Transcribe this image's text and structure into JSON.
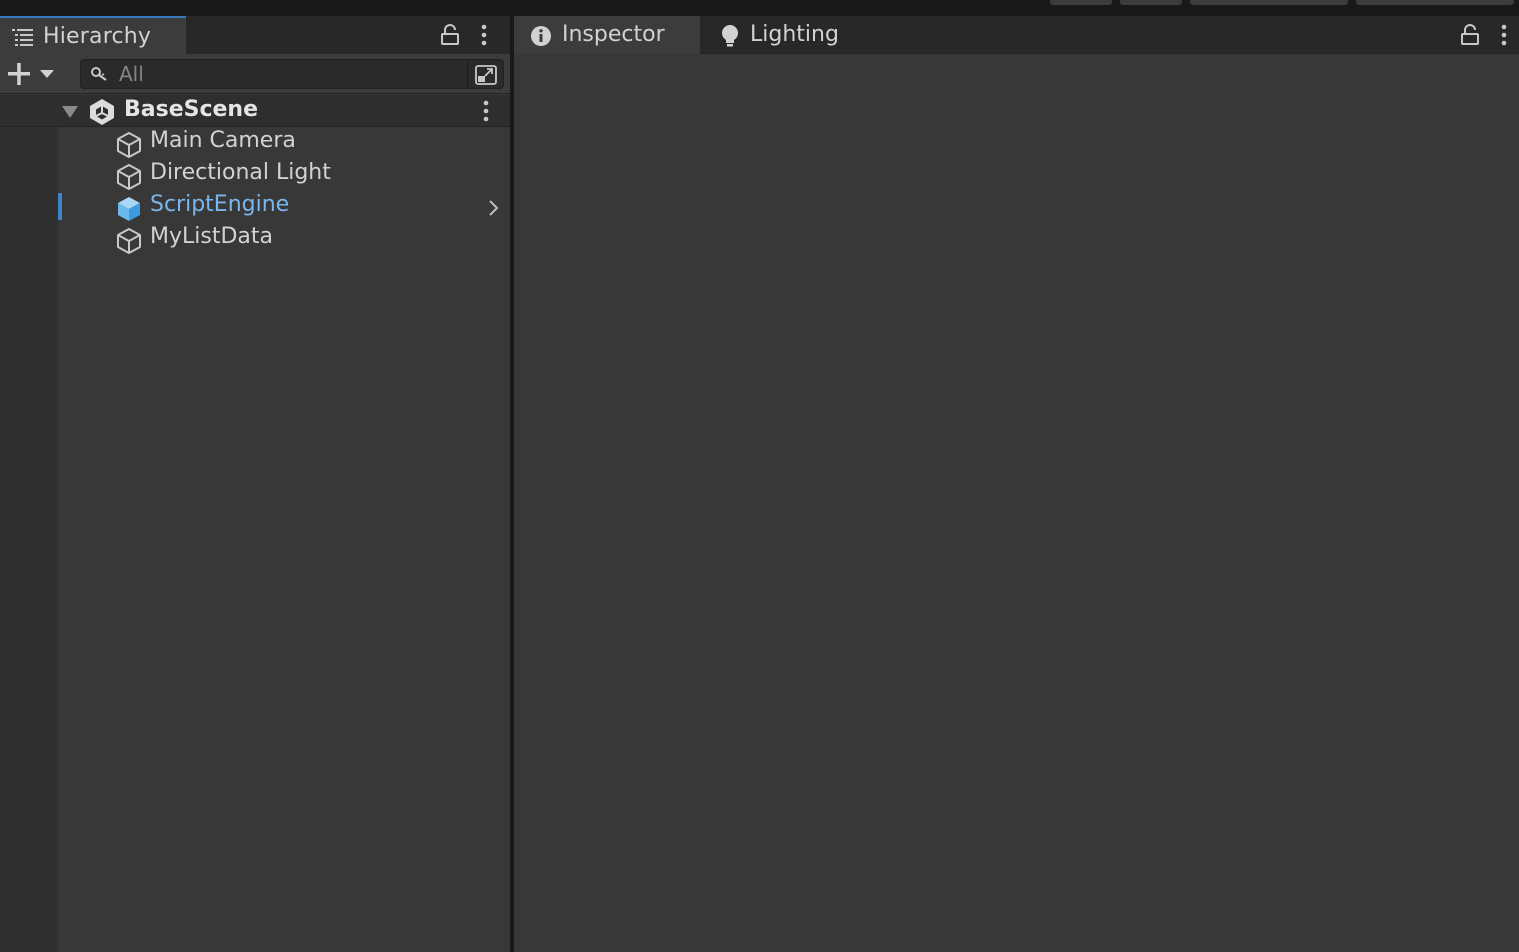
{
  "colors": {
    "accent": "#3a79bb",
    "selected_text": "#7ab6ee",
    "panel_bg": "#383838",
    "tabbar_bg": "#282828"
  },
  "hierarchy": {
    "tab_label": "Hierarchy",
    "tab_icon": "list-icon",
    "search": {
      "placeholder": "All",
      "value": ""
    },
    "scene": {
      "name": "BaseScene",
      "icon": "unity-scene-icon"
    },
    "items": [
      {
        "label": "Main Camera",
        "icon": "gameobject-icon",
        "selected": false
      },
      {
        "label": "Directional Light",
        "icon": "gameobject-icon",
        "selected": false
      },
      {
        "label": "ScriptEngine",
        "icon": "gameobject-icon",
        "selected": true,
        "has_children": true
      },
      {
        "label": "MyListData",
        "icon": "gameobject-icon",
        "selected": false
      }
    ]
  },
  "inspector": {
    "tabs": [
      {
        "label": "Inspector",
        "icon": "info-icon",
        "active": true
      },
      {
        "label": "Lighting",
        "icon": "lightbulb-icon",
        "active": false
      }
    ]
  }
}
